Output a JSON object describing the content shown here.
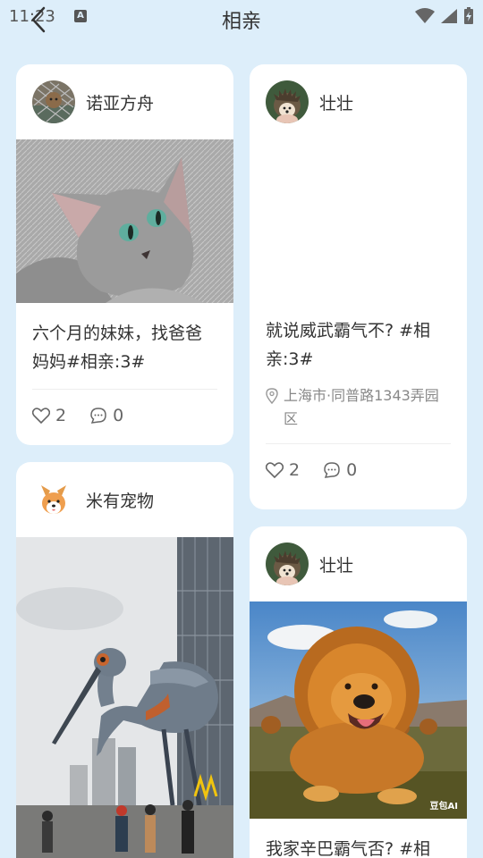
{
  "status_bar": {
    "time": "11:23",
    "notification_letter": "A"
  },
  "header": {
    "title": "相亲"
  },
  "posts": [
    {
      "username": "诺亚方舟",
      "avatar": "cat-photo-avatar",
      "image": "gray-kitten-photo",
      "text": "六个月的妹妹，找爸爸妈妈#相亲:3#",
      "likes": "2",
      "comments": "0"
    },
    {
      "username": "壮壮",
      "avatar": "hedgehog-avatar",
      "text": "就说威武霸气不? #相亲:3#",
      "location": "上海市·同普路1343弄园区",
      "likes": "2",
      "comments": "0"
    },
    {
      "username": "米有宠物",
      "avatar": "corgi-cartoon-avatar",
      "image": "crane-sculpture-photo"
    },
    {
      "username": "壮壮",
      "avatar": "hedgehog-avatar",
      "image": "lion-dog-photo",
      "image_watermark": "豆包AI",
      "text": "我家辛巴霸气否? #相"
    }
  ],
  "colors": {
    "background": "#ddeefa",
    "card": "#ffffff",
    "text": "#333333",
    "muted": "#888888"
  }
}
